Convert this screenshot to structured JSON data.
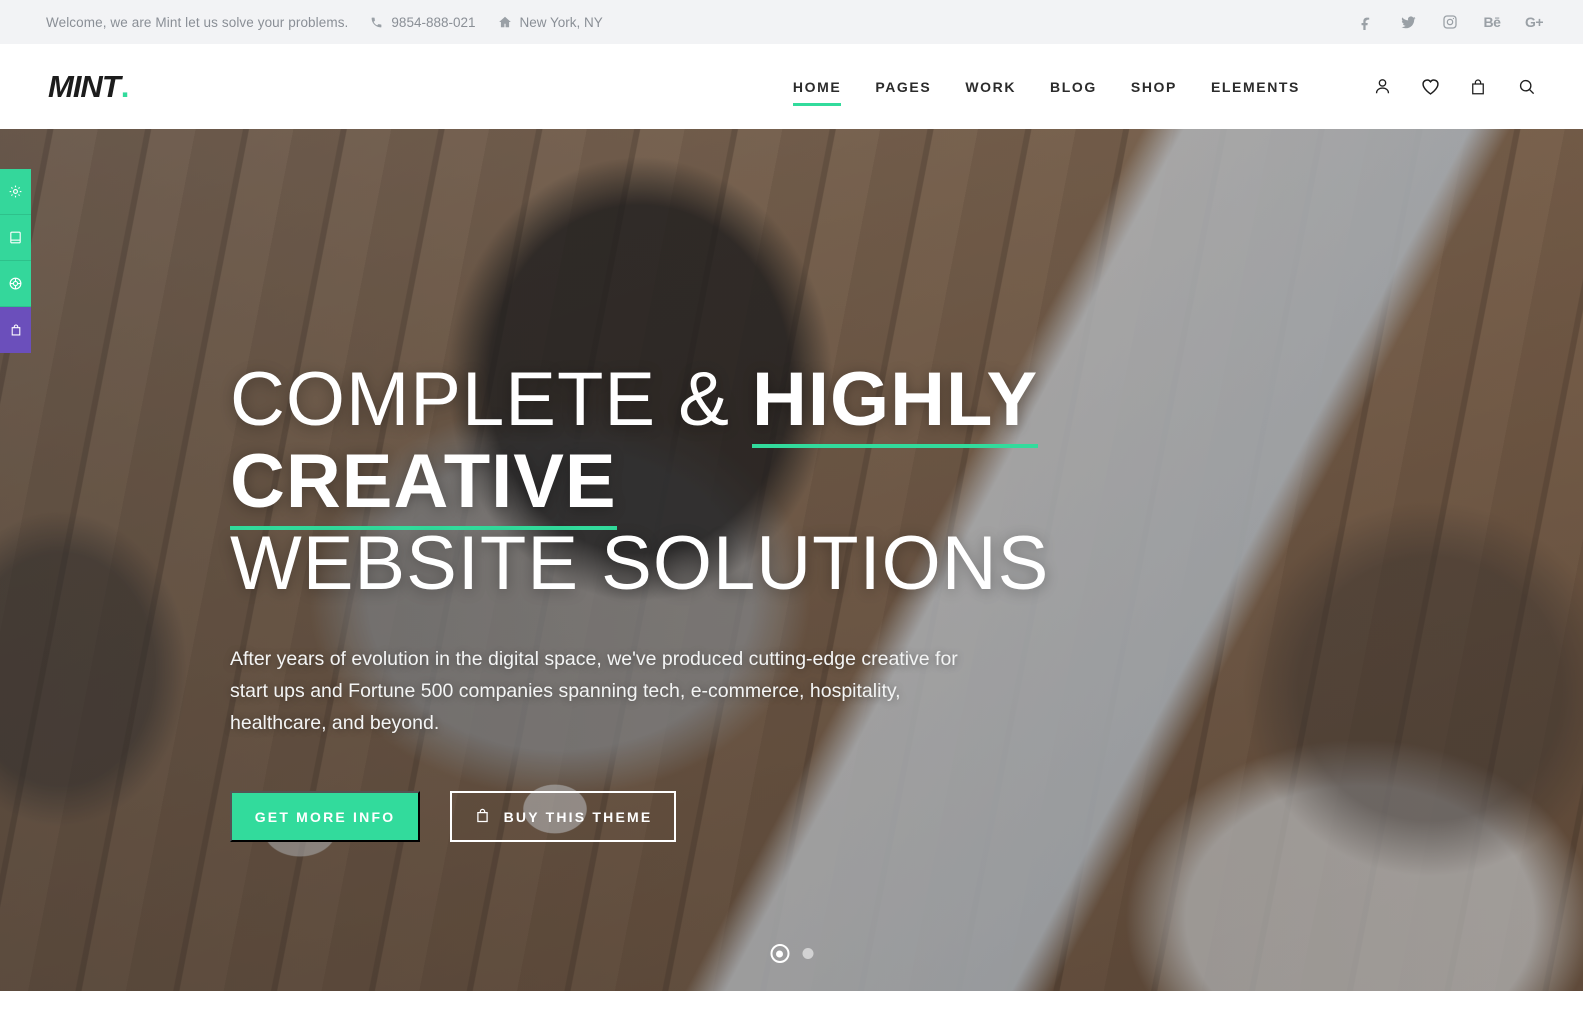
{
  "topbar": {
    "welcome": "Welcome, we are Mint let us solve your problems.",
    "phone_icon": "phone-icon",
    "phone": "9854-888-021",
    "location_icon": "home-icon",
    "location": "New York, NY",
    "socials": [
      {
        "name": "facebook-icon",
        "glyph": "f"
      },
      {
        "name": "twitter-icon",
        "glyph": "t"
      },
      {
        "name": "instagram-icon",
        "glyph": "ig"
      },
      {
        "name": "behance-icon",
        "glyph": "Bē"
      },
      {
        "name": "google-plus-icon",
        "glyph": "G+"
      }
    ],
    "background": "#f2f3f5",
    "text_color": "#8a8f96"
  },
  "header": {
    "logo_text": "MINT",
    "logo_dot": ".",
    "nav": [
      {
        "label": "HOME",
        "active": true
      },
      {
        "label": "PAGES",
        "active": false
      },
      {
        "label": "WORK",
        "active": false
      },
      {
        "label": "BLOG",
        "active": false
      },
      {
        "label": "SHOP",
        "active": false
      },
      {
        "label": "ELEMENTS",
        "active": false
      }
    ],
    "icons": [
      {
        "name": "account-icon"
      },
      {
        "name": "wishlist-heart-icon"
      },
      {
        "name": "shopping-bag-icon"
      },
      {
        "name": "search-icon"
      }
    ]
  },
  "sidetools": [
    {
      "name": "settings-gear-icon",
      "color": "#34d79b"
    },
    {
      "name": "layout-page-icon",
      "color": "#34d79b"
    },
    {
      "name": "support-lifebuoy-icon",
      "color": "#34d79b"
    },
    {
      "name": "purchase-bag-icon",
      "color": "#6b4fbb"
    }
  ],
  "hero": {
    "title_line1_light": "COMPLETE &",
    "title_line1_strong": "HIGHLY CREATIVE",
    "title_line2": "WEBSITE SOLUTIONS",
    "subtitle": "After years of evolution in the digital space, we've produced cutting-edge creative for start ups and Fortune 500 companies spanning tech, e-commerce, hospitality, healthcare, and beyond.",
    "primary_button": "GET MORE INFO",
    "secondary_button": "BUY THIS THEME",
    "secondary_button_icon": "shopping-bag-icon",
    "slides": [
      {
        "label": "slide-1",
        "active": true
      },
      {
        "label": "slide-2",
        "active": false
      }
    ]
  },
  "colors": {
    "accent_mint": "#32db9c",
    "accent_purple": "#6b4fbb",
    "text_dark": "#2b2b2b",
    "topbar_bg": "#f2f3f5"
  }
}
